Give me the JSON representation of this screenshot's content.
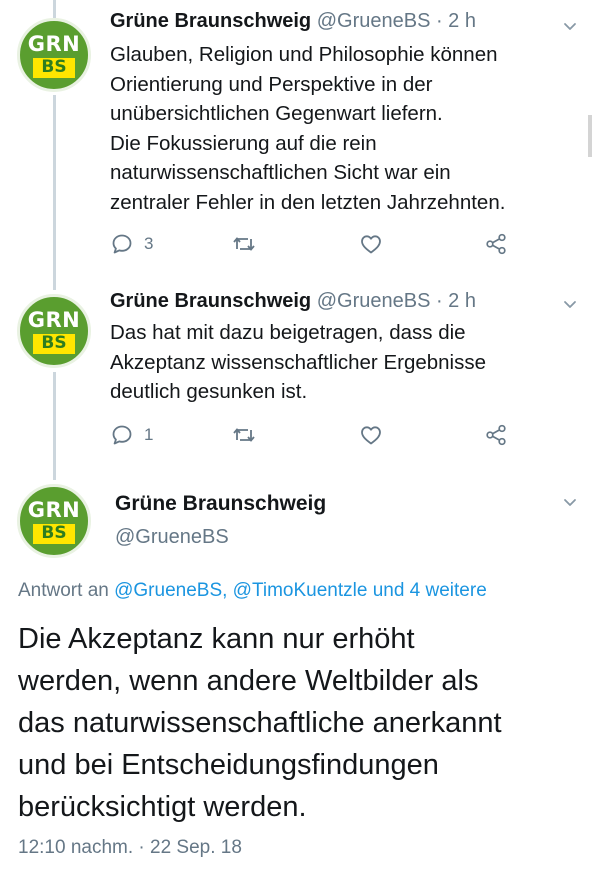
{
  "tweets": [
    {
      "author_name": "Grüne Braunschweig",
      "author_handle": "@GrueneBS · 2 h",
      "avatar_top": "GRN",
      "avatar_bottom": "BS",
      "text": "Glauben, Religion und Philosophie können\nOrientierung und Perspektive in der\nunübersichtlichen Gegenwart liefern.\nDie Fokussierung auf die rein\nnaturwissenschaftlichen Sicht war ein\nzentraler Fehler in den letzten Jahrzehnten.",
      "reply_count": "3",
      "icons": [
        "reply-icon",
        "retweet-icon",
        "like-icon",
        "share-icon"
      ]
    },
    {
      "author_name": "Grüne Braunschweig",
      "author_handle": "@GrueneBS · 2 h",
      "avatar_top": "GRN",
      "avatar_bottom": "BS",
      "text": "Das hat mit dazu beigetragen, dass die\nAkzeptanz wissenschaftlicher Ergebnisse\ndeutlich gesunken ist.",
      "reply_count": "1",
      "icons": [
        "reply-icon",
        "retweet-icon",
        "like-icon",
        "share-icon"
      ]
    }
  ],
  "main_tweet": {
    "author_name": "Grüne Braunschweig",
    "author_handle": "@GrueneBS",
    "avatar_top": "GRN",
    "avatar_bottom": "BS",
    "reply_prefix": "Antwort an",
    "reply_links": "@GrueneBS, @TimoKuentzle und 4 weitere",
    "text": "Die Akzeptanz kann nur erhöht\nwerden, wenn andere Weltbilder als\ndas naturwissenschaftliche anerkannt\nund bei Entscheidungsfindungen\nberücksichtigt werden.",
    "timestamp": "12:10 nachm. · 22 Sep. 18"
  },
  "colors": {
    "text": "#14171a",
    "secondary": "#657786",
    "link": "#1b95e0",
    "avatar_green": "#5a9e2f",
    "avatar_yellow": "#ffe600",
    "thread_line": "#ccd6dd"
  }
}
